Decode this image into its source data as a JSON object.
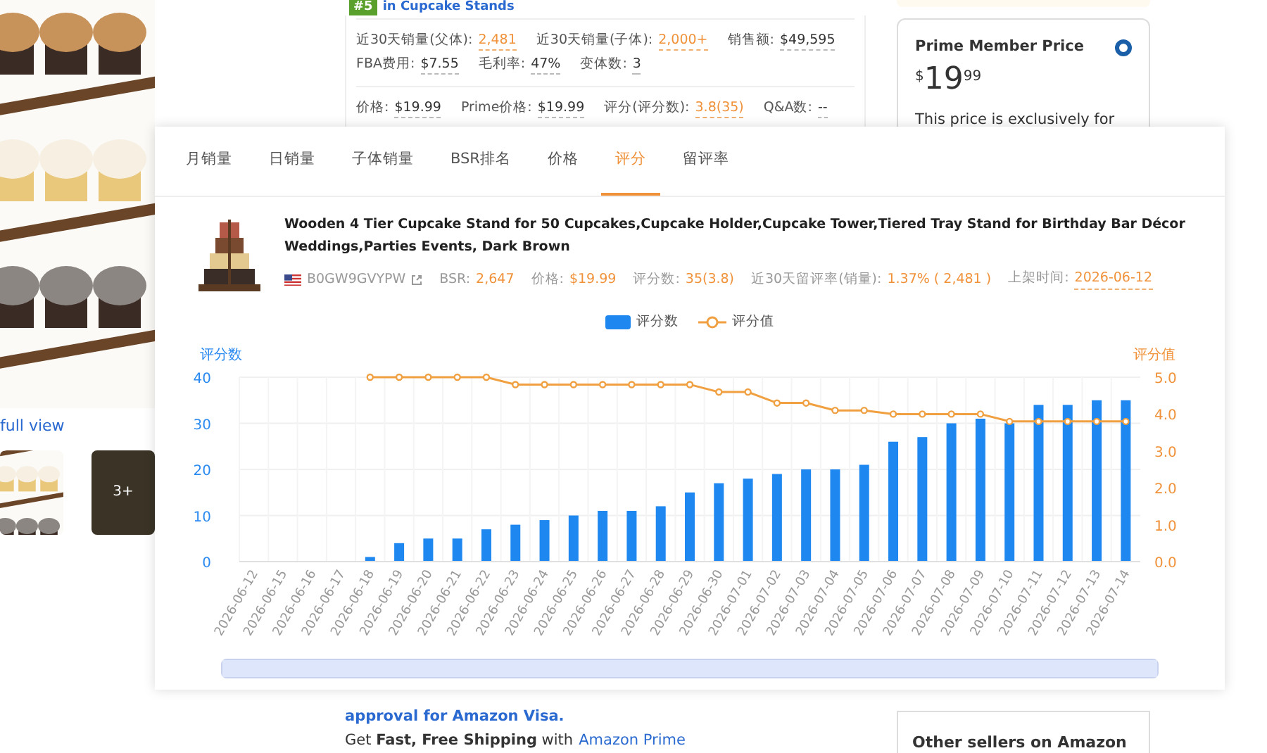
{
  "listing": {
    "rank_badge": "#5",
    "rank_category": "in Cupcake Stands",
    "stat_rows": [
      [
        {
          "label": "近30天销量(父体):",
          "value": "2,481",
          "highlight": true
        },
        {
          "label": "近30天销量(子体):",
          "value": "2,000+",
          "highlight": true
        },
        {
          "label": "销售额:",
          "value": "$49,595",
          "highlight": false
        }
      ],
      [
        {
          "label": "FBA费用:",
          "value": "$7.55",
          "highlight": false
        },
        {
          "label": "毛利率:",
          "value": "47%",
          "highlight": false
        },
        {
          "label": "变体数:",
          "value": "3",
          "highlight": false
        }
      ],
      [
        {
          "label": "价格:",
          "value": "$19.99",
          "highlight": false
        },
        {
          "label": "Prime价格:",
          "value": "$19.99",
          "highlight": false
        },
        {
          "label": "评分(评分数):",
          "value": "3.8(35)",
          "highlight": true
        },
        {
          "label": "Q&A数:",
          "value": "--",
          "highlight": false
        }
      ]
    ],
    "full_view_link": "full view",
    "thumb_more": "3+",
    "visa_text": "approval for Amazon Visa.",
    "shipping_text": "Get **Fast, Free Shipping** with",
    "prime_link": "Amazon Prime",
    "prime_card": {
      "title": "Prime Member Price",
      "selected": true,
      "currency": "$",
      "whole": "19",
      "fraction": "99",
      "note": "This price is exclusively for"
    },
    "other_sellers": "Other sellers on Amazon",
    "zoom_slider": {
      "level": 1
    }
  },
  "popup": {
    "tabs": [
      {
        "label": "月销量",
        "selected": false
      },
      {
        "label": "日销量",
        "selected": false
      },
      {
        "label": "子体销量",
        "selected": false
      },
      {
        "label": "BSR排名",
        "selected": false
      },
      {
        "label": "价格",
        "selected": false
      },
      {
        "label": "评分",
        "selected": true
      },
      {
        "label": "留评率",
        "selected": false
      }
    ],
    "product": {
      "title": "Wooden 4 Tier Cupcake Stand for 50 Cupcakes,Cupcake Holder,Cupcake Tower,Tiered Tray Stand for Birthday Bar Décor Weddings,Parties Events, Dark Brown",
      "asin": "B0GW9GVYPW",
      "meta": [
        {
          "label": "BSR:",
          "value": "2,647"
        },
        {
          "label": "价格:",
          "value": "$19.99"
        },
        {
          "label": "评分数:",
          "value": "35(3.8)"
        },
        {
          "label": "近30天留评率(销量):",
          "value": "1.37% ( 2,481 )"
        },
        {
          "label": "上架时间:",
          "value": "2026-06-12"
        }
      ]
    },
    "chart_data": {
      "type": "bar",
      "ylabel": "评分数",
      "y2label": "评分值",
      "categories": [
        "2026-06-12",
        "2026-06-15",
        "2026-06-16",
        "2026-06-17",
        "2026-06-18",
        "2026-06-19",
        "2026-06-20",
        "2026-06-21",
        "2026-06-22",
        "2026-06-23",
        "2026-06-24",
        "2026-06-25",
        "2026-06-26",
        "2026-06-27",
        "2026-06-28",
        "2026-06-29",
        "2026-06-30",
        "2026-07-01",
        "2026-07-02",
        "2026-07-03",
        "2026-07-04",
        "2026-07-05",
        "2026-07-06",
        "2026-07-07",
        "2026-07-08",
        "2026-07-09",
        "2026-07-10",
        "2026-07-11",
        "2026-07-12",
        "2026-07-13",
        "2026-07-14"
      ],
      "series": [
        {
          "name": "评分数",
          "color": "#1e88f0",
          "values": [
            0,
            0,
            0,
            0,
            1,
            4,
            5,
            5,
            7,
            8,
            9,
            10,
            11,
            11,
            12,
            15,
            17,
            18,
            19,
            20,
            20,
            21,
            26,
            27,
            30,
            31,
            30,
            34,
            34,
            35,
            35
          ]
        },
        {
          "name": "评分值",
          "color": "#f0a040",
          "type": "line",
          "marker": "o",
          "axis": "y2",
          "values": [
            null,
            null,
            null,
            null,
            5.0,
            5.0,
            5.0,
            5.0,
            5.0,
            4.8,
            4.8,
            4.8,
            4.8,
            4.8,
            4.8,
            4.8,
            4.6,
            4.6,
            4.3,
            4.3,
            4.1,
            4.1,
            4.0,
            4.0,
            4.0,
            4.0,
            3.8,
            3.8,
            3.8,
            3.8,
            3.8
          ]
        }
      ],
      "grid": true,
      "ylim": [
        0,
        40
      ],
      "yticks": [
        0,
        10,
        20,
        30,
        40
      ],
      "y2lim": [
        0,
        5
      ],
      "y2ticks": [
        {
          "value": 0,
          "label": "0.0"
        },
        {
          "value": 1,
          "label": "1.0"
        },
        {
          "value": 2,
          "label": "2.0"
        },
        {
          "value": 3,
          "label": "3.0"
        },
        {
          "value": 4,
          "label": "4.0"
        },
        {
          "value": 5,
          "label": "5.0"
        }
      ]
    }
  }
}
